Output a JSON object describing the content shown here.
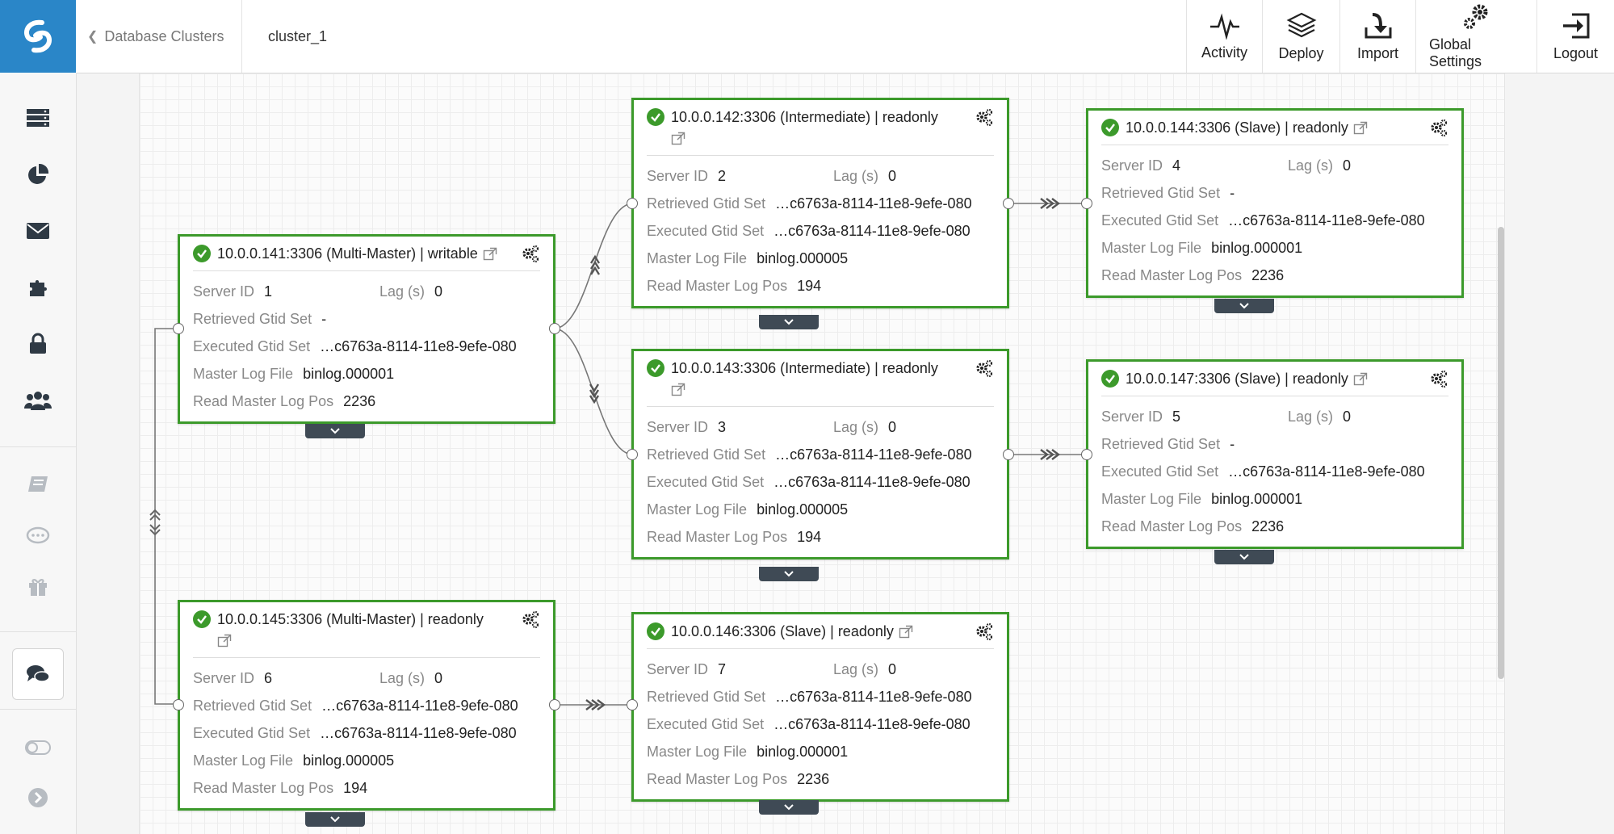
{
  "header": {
    "breadcrumb": "Database Clusters",
    "cluster_name": "cluster_1",
    "nav": [
      {
        "label": "Activity",
        "icon": "activity-icon"
      },
      {
        "label": "Deploy",
        "icon": "layers-icon"
      },
      {
        "label": "Import",
        "icon": "import-icon"
      },
      {
        "label": "Global Settings",
        "icon": "gears-icon"
      },
      {
        "label": "Logout",
        "icon": "logout-icon"
      }
    ]
  },
  "sidebar": {
    "items": [
      "servers-icon",
      "pie-chart-icon",
      "mail-icon",
      "puzzle-icon",
      "lock-icon",
      "users-icon",
      "book-icon",
      "comment-icon",
      "gift-icon",
      "chat-icon",
      "toggle-icon",
      "chevron-right-icon"
    ]
  },
  "labels": {
    "server_id": "Server ID",
    "lag": "Lag (s)",
    "retrieved": "Retrieved Gtid Set",
    "executed": "Executed Gtid Set",
    "master_log": "Master Log File",
    "read_pos": "Read Master Log Pos"
  },
  "nodes": [
    {
      "title": "10.0.0.141:3306 (Multi-Master) | writable",
      "server_id": "1",
      "lag": "0",
      "retrieved": "-",
      "executed": "…c6763a-8114-11e8-9efe-080",
      "master_log": "binlog.000001",
      "read_pos": "2236"
    },
    {
      "title": "10.0.0.142:3306 (Intermediate) | readonly",
      "server_id": "2",
      "lag": "0",
      "retrieved": "…c6763a-8114-11e8-9efe-080",
      "executed": "…c6763a-8114-11e8-9efe-080",
      "master_log": "binlog.000005",
      "read_pos": "194"
    },
    {
      "title": "10.0.0.144:3306 (Slave) | readonly",
      "server_id": "4",
      "lag": "0",
      "retrieved": "-",
      "executed": "…c6763a-8114-11e8-9efe-080",
      "master_log": "binlog.000001",
      "read_pos": "2236"
    },
    {
      "title": "10.0.0.143:3306 (Intermediate) | readonly",
      "server_id": "3",
      "lag": "0",
      "retrieved": "…c6763a-8114-11e8-9efe-080",
      "executed": "…c6763a-8114-11e8-9efe-080",
      "master_log": "binlog.000005",
      "read_pos": "194"
    },
    {
      "title": "10.0.0.147:3306 (Slave) | readonly",
      "server_id": "5",
      "lag": "0",
      "retrieved": "-",
      "executed": "…c6763a-8114-11e8-9efe-080",
      "master_log": "binlog.000001",
      "read_pos": "2236"
    },
    {
      "title": "10.0.0.145:3306 (Multi-Master) | readonly",
      "server_id": "6",
      "lag": "0",
      "retrieved": "…c6763a-8114-11e8-9efe-080",
      "executed": "…c6763a-8114-11e8-9efe-080",
      "master_log": "binlog.000005",
      "read_pos": "194"
    },
    {
      "title": "10.0.0.146:3306 (Slave) | readonly",
      "server_id": "7",
      "lag": "0",
      "retrieved": "…c6763a-8114-11e8-9efe-080",
      "executed": "…c6763a-8114-11e8-9efe-080",
      "master_log": "binlog.000001",
      "read_pos": "2236"
    }
  ],
  "colors": {
    "accent": "#2a86c8",
    "node_border": "#3c9a2b",
    "tab": "#3f4a55"
  }
}
